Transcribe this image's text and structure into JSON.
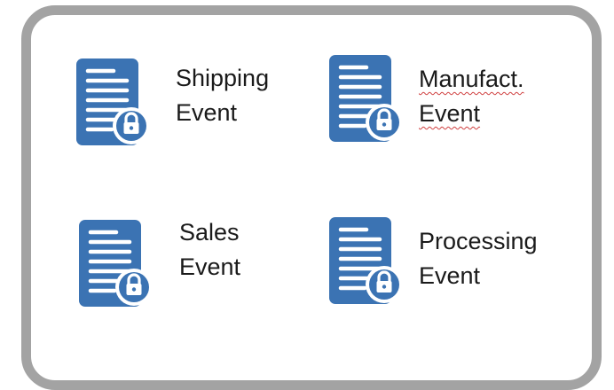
{
  "items": [
    {
      "line1": "Shipping",
      "line2": "Event",
      "icon": "locked-document-icon"
    },
    {
      "line1": "Manufact.",
      "line2": "Event",
      "icon": "locked-document-icon"
    },
    {
      "line1": "Sales",
      "line2": "Event",
      "icon": "locked-document-icon"
    },
    {
      "line1": "Processing",
      "line2": "Event",
      "icon": "locked-document-icon"
    }
  ],
  "colors": {
    "icon_blue": "#3b73b3",
    "frame_gray": "#a3a3a3",
    "spellcheck_red": "#d04040"
  }
}
